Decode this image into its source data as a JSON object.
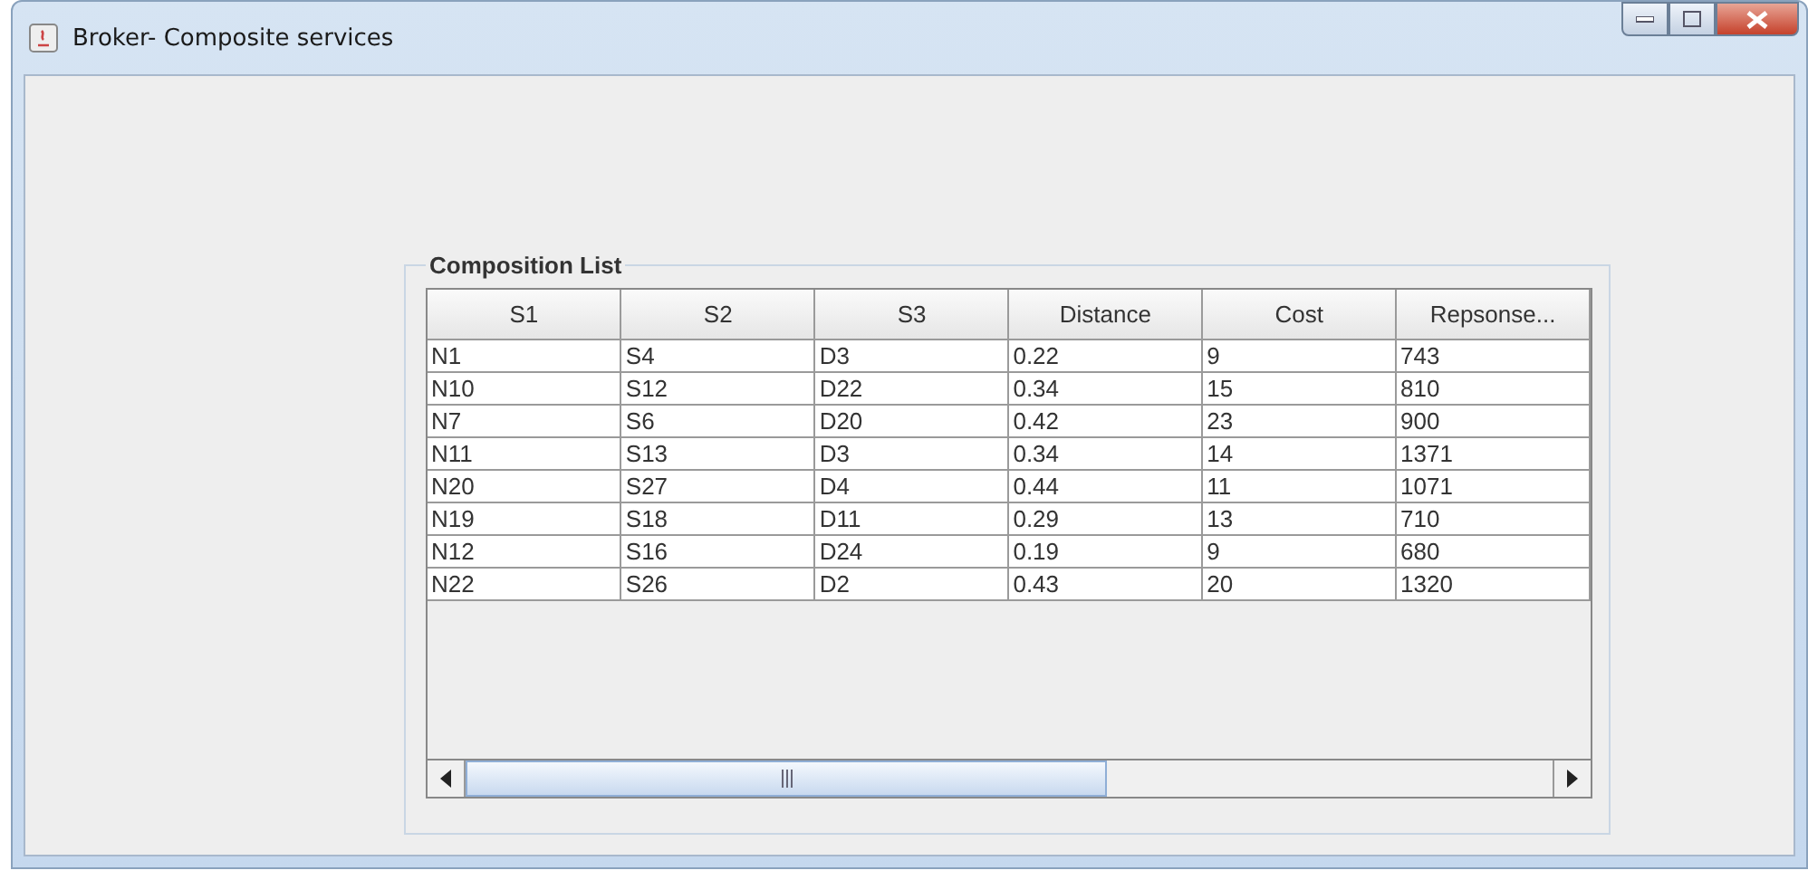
{
  "window": {
    "title": "Broker- Composite services"
  },
  "group": {
    "title": "Composition List"
  },
  "table": {
    "columns": [
      "S1",
      "S2",
      "S3",
      "Distance",
      "Cost",
      "Repsonse..."
    ],
    "rows": [
      [
        "N1",
        "S4",
        "D3",
        "0.22",
        "9",
        "743"
      ],
      [
        "N10",
        "S12",
        "D22",
        "0.34",
        "15",
        "810"
      ],
      [
        "N7",
        "S6",
        "D20",
        "0.42",
        "23",
        "900"
      ],
      [
        "N11",
        "S13",
        "D3",
        "0.34",
        "14",
        "1371"
      ],
      [
        "N20",
        "S27",
        "D4",
        "0.44",
        "11",
        "1071"
      ],
      [
        "N19",
        "S18",
        "D11",
        "0.29",
        "13",
        "710"
      ],
      [
        "N12",
        "S16",
        "D24",
        "0.19",
        "9",
        "680"
      ],
      [
        "N22",
        "S26",
        "D2",
        "0.43",
        "20",
        "1320"
      ]
    ]
  }
}
